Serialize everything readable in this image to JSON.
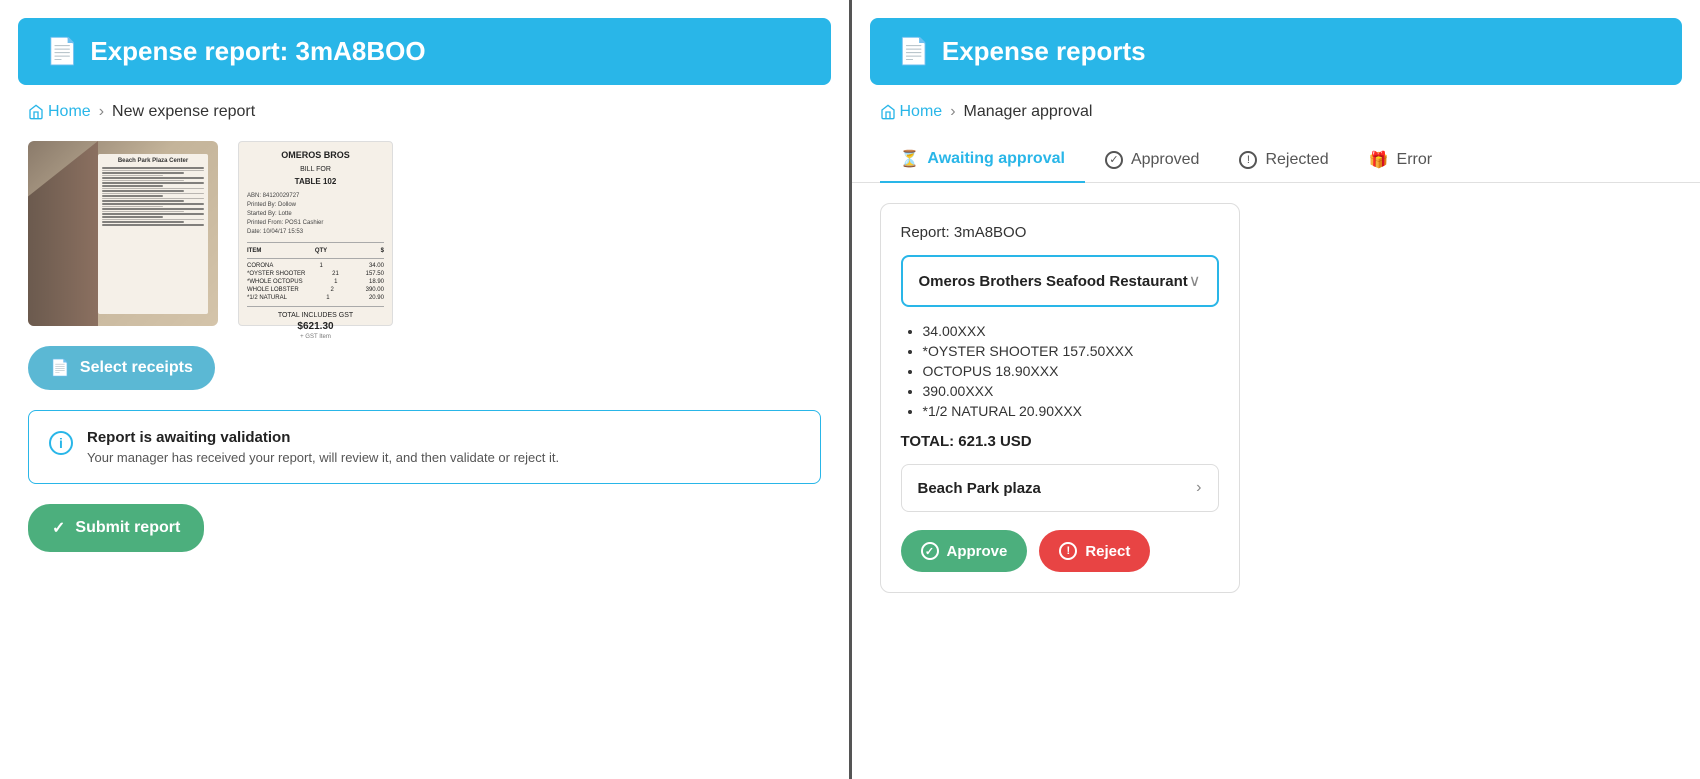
{
  "left_panel": {
    "header": {
      "icon": "📄",
      "title": "Expense report: 3mA8BOO"
    },
    "breadcrumb": {
      "home": "Home",
      "separator": "›",
      "current": "New expense report"
    },
    "select_receipts_btn": "Select receipts",
    "validation": {
      "title": "Report is awaiting validation",
      "description": "Your manager has received your report, will review it, and then validate or reject it."
    },
    "submit_btn": "Submit report",
    "receipt2": {
      "title": "OMEROS BROS",
      "subtitle": "BILL FOR",
      "table": "TABLE 102",
      "rows": [
        {
          "item": "CORONA",
          "qty": "1",
          "price": "34.00"
        },
        {
          "item": "*OYSTER SHOOTER",
          "qty": "21",
          "price": "157.50"
        },
        {
          "item": "*WHOLE OCTOPUS",
          "qty": "1",
          "price": "18.90"
        },
        {
          "item": "WHOLE LOBSTER",
          "qty": "2",
          "price": "390.00"
        },
        {
          "item": "*1/2 NATURAL",
          "qty": "1",
          "price": "20.90"
        }
      ],
      "total": "TOTAL INCLUDES GST",
      "total_amount": "$621.30"
    }
  },
  "right_panel": {
    "header": {
      "icon": "📄",
      "title": "Expense reports"
    },
    "breadcrumb": {
      "home": "Home",
      "separator": "›",
      "current": "Manager approval"
    },
    "tabs": [
      {
        "id": "awaiting",
        "label": "Awaiting approval",
        "icon": "⏳",
        "active": true
      },
      {
        "id": "approved",
        "label": "Approved",
        "icon": "✓"
      },
      {
        "id": "rejected",
        "label": "Rejected",
        "icon": "⚠"
      },
      {
        "id": "error",
        "label": "Error",
        "icon": "🎁"
      }
    ],
    "report": {
      "title": "Report: 3mA8BOO",
      "restaurant": "Omeros Brothers Seafood Restaurant",
      "items": [
        "34.00XXX",
        "*OYSTER SHOOTER 157.50XXX",
        "OCTOPUS 18.90XXX",
        "390.00XXX",
        "*1/2 NATURAL 20.90XXX"
      ],
      "total": "TOTAL: 621.3 USD",
      "second_receipt": "Beach Park plaza",
      "approve_btn": "Approve",
      "reject_btn": "Reject"
    }
  }
}
